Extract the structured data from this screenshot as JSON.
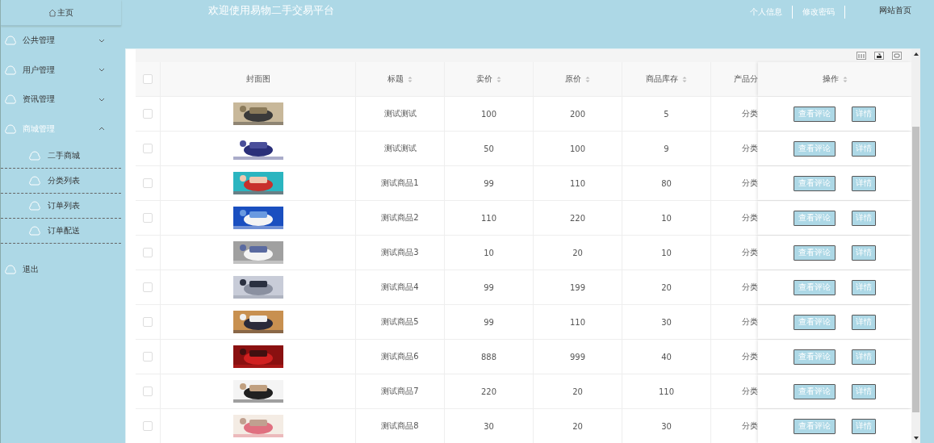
{
  "sidebar": {
    "home": "主页",
    "menu": [
      {
        "label": "公共管理",
        "expanded": false
      },
      {
        "label": "用户管理",
        "expanded": false
      },
      {
        "label": "资讯管理",
        "expanded": false
      },
      {
        "label": "商城管理",
        "expanded": true,
        "children": [
          {
            "label": "二手商城"
          },
          {
            "label": "分类列表"
          },
          {
            "label": "订单列表"
          },
          {
            "label": "订单配送"
          }
        ]
      }
    ],
    "logout": "退出"
  },
  "header": {
    "title": "欢迎使用易物二手交易平台",
    "links": [
      "个人信息",
      "修改密码"
    ],
    "site_link": "网站首页"
  },
  "table": {
    "all_checked": false,
    "columns": [
      {
        "label": "封面图",
        "sortable": false
      },
      {
        "label": "标题",
        "sortable": true
      },
      {
        "label": "卖价",
        "sortable": true
      },
      {
        "label": "原价",
        "sortable": true
      },
      {
        "label": "商品库存",
        "sortable": true
      },
      {
        "label": "产品分",
        "sortable": false
      },
      {
        "label": "操作",
        "sortable": true
      }
    ],
    "rows": [
      {
        "checked": false,
        "title": "测试测试",
        "price": "100",
        "original": "200",
        "stock": "5",
        "category": "分类",
        "actions": [
          "查看评论",
          "详情"
        ]
      },
      {
        "checked": false,
        "title": "测试测试",
        "price": "50",
        "original": "100",
        "stock": "9",
        "category": "分类",
        "actions": [
          "查看评论",
          "详情"
        ]
      },
      {
        "checked": false,
        "title": "测试商品1",
        "price": "99",
        "original": "110",
        "stock": "80",
        "category": "分类",
        "actions": [
          "查看评论",
          "详情"
        ]
      },
      {
        "checked": false,
        "title": "测试商品2",
        "price": "110",
        "original": "220",
        "stock": "10",
        "category": "分类",
        "actions": [
          "查看评论",
          "详情"
        ]
      },
      {
        "checked": false,
        "title": "测试商品3",
        "price": "10",
        "original": "20",
        "stock": "10",
        "category": "分类",
        "actions": [
          "查看评论",
          "详情"
        ]
      },
      {
        "checked": false,
        "title": "测试商品4",
        "price": "99",
        "original": "199",
        "stock": "20",
        "category": "分类",
        "actions": [
          "查看评论",
          "详情"
        ]
      },
      {
        "checked": false,
        "title": "测试商品5",
        "price": "99",
        "original": "110",
        "stock": "30",
        "category": "分类",
        "actions": [
          "查看评论",
          "详情"
        ]
      },
      {
        "checked": false,
        "title": "测试商品6",
        "price": "888",
        "original": "999",
        "stock": "40",
        "category": "分类",
        "actions": [
          "查看评论",
          "详情"
        ]
      },
      {
        "checked": false,
        "title": "测试商品7",
        "price": "220",
        "original": "20",
        "stock": "110",
        "category": "分类",
        "actions": [
          "查看评论",
          "详情"
        ]
      },
      {
        "checked": false,
        "title": "测试商品8",
        "price": "30",
        "original": "20",
        "stock": "30",
        "category": "分类",
        "actions": [
          "查看评论",
          "详情"
        ]
      }
    ]
  }
}
